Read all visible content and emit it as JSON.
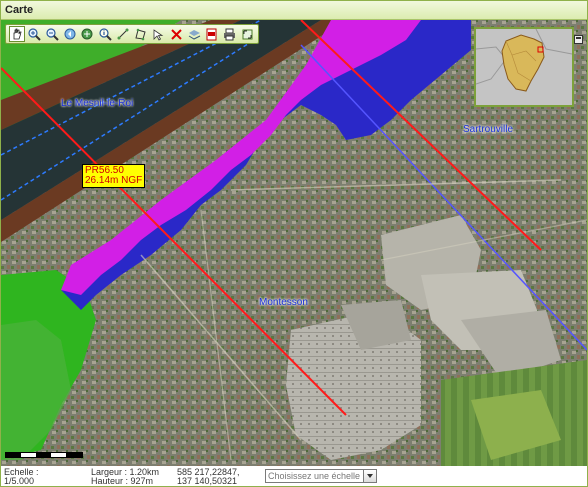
{
  "window": {
    "title": "Carte"
  },
  "toolbar": {
    "tools": [
      {
        "name": "pan-hand-icon",
        "active": true
      },
      {
        "name": "zoom-in-icon"
      },
      {
        "name": "zoom-out-icon"
      },
      {
        "name": "zoom-previous-icon"
      },
      {
        "name": "zoom-full-icon"
      },
      {
        "name": "info-icon"
      },
      {
        "name": "measure-distance-icon"
      },
      {
        "name": "measure-area-icon"
      },
      {
        "name": "select-feature-icon"
      },
      {
        "name": "clear-icon"
      },
      {
        "name": "layers-icon"
      },
      {
        "name": "pdf-icon"
      },
      {
        "name": "print-icon"
      },
      {
        "name": "fullscreen-icon"
      }
    ]
  },
  "map": {
    "labels": {
      "mesnil": "Le Mesnil-le-Roi",
      "sartrouville": "Sartrouville",
      "montesson": "Montesson"
    },
    "pr_marker": {
      "line1": "PR56.50",
      "line2": "26.14m NGF"
    },
    "colors": {
      "flood_high": "#d21fe6",
      "flood_low": "#2a28c8",
      "river_line": "#ff1a1a",
      "flood_green": "#2fb51f"
    }
  },
  "status": {
    "scale_label": "Echelle :",
    "scale_value": "1/5.000",
    "width_label": "Largeur : 1.20km",
    "height_label": "Hauteur : 927m",
    "coord_x": "585 217,22847,",
    "coord_y": "137 140,50321",
    "scale_select_placeholder": "Choisissez une échelle"
  }
}
